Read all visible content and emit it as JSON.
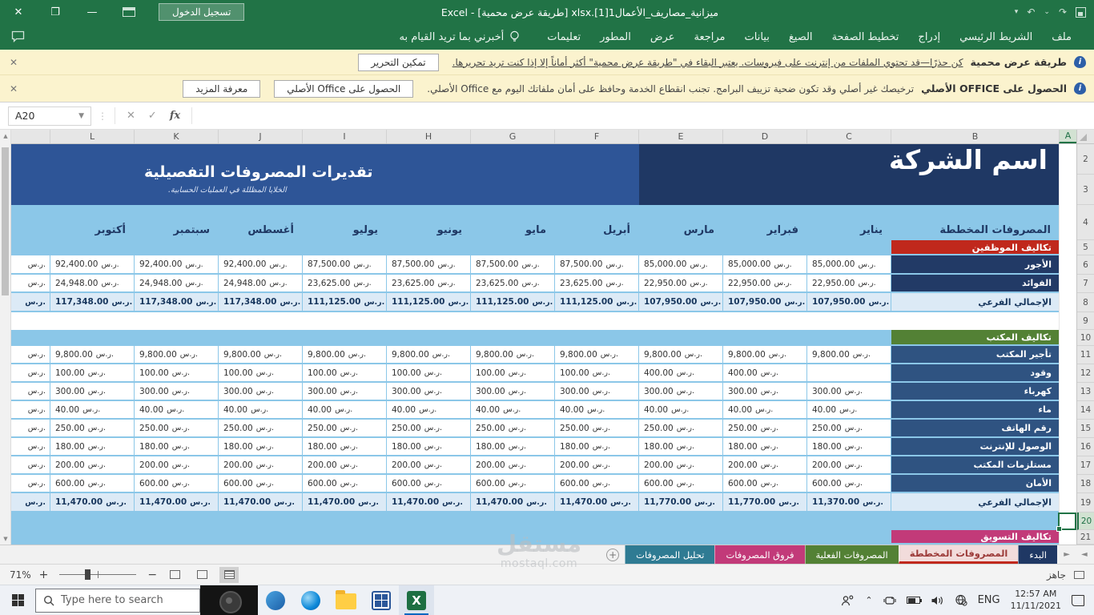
{
  "window": {
    "title": "ميزانية_مصاريف_الأعمال1[1].xlsx [طريقة عرض محمية] - Excel",
    "sign_in_label": "تسجيل الدخول"
  },
  "ribbon": {
    "tabs": [
      "ملف",
      "الشريط الرئيسي",
      "إدراج",
      "تخطيط الصفحة",
      "الصيغ",
      "بيانات",
      "مراجعة",
      "عرض",
      "المطور",
      "تعليمات"
    ],
    "tell_me": "أخبرني بما تريد القيام به"
  },
  "protected_bar": {
    "title": "طريقة عرض محمية",
    "message": "كن حذرًا—قد تحتوي الملفات من إنترنت على فيروسات. يعتبر البقاء في \"طريقة عرض محمية\" أكثر أماناً إلا إذا كنت تريد تحريرها.",
    "button": "تمكين التحرير"
  },
  "genuine_bar": {
    "title": "الحصول على OFFICE الأصلي",
    "message": "ترخيصك غير أصلي وقد تكون ضحية تزييف البرامج. تجنب انقطاع الخدمة وحافظ على أمان ملفاتك اليوم مع Office الأصلي.",
    "button_primary": "الحصول على Office الأصلي",
    "button_secondary": "معرفة المزيد"
  },
  "formula_bar": {
    "name_box": "A20",
    "function_label": "fx",
    "formula": ""
  },
  "grid": {
    "columns": [
      "A",
      "B",
      "C",
      "D",
      "E",
      "F",
      "G",
      "H",
      "I",
      "J",
      "K",
      "L"
    ],
    "rows": [
      "2",
      "3",
      "4",
      "5",
      "6",
      "7",
      "8",
      "9",
      "10",
      "11",
      "12",
      "13",
      "14",
      "15",
      "16",
      "17",
      "18",
      "19",
      "20",
      "21"
    ],
    "active_cell": "A20",
    "accent_color": "#217346"
  },
  "sheet": {
    "company_name": "اسم الشركة",
    "title": "تقديرات المصروفات التفصيلية",
    "subtitle": "الخلايا المظللة في العمليات الحسابية.",
    "header_label": "المصروفات المخططة",
    "months": [
      "يناير",
      "فبراير",
      "مارس",
      "أبريل",
      "مايو",
      "يونيو",
      "يوليو",
      "أغسطس",
      "سبتمبر",
      "أكتوبر"
    ],
    "currency": "ر.س.",
    "sections": [
      {
        "header": "تكاليف الموظفين",
        "color": "#c0281c",
        "row_bg": "#223a66",
        "rows": [
          {
            "label": "الأجور",
            "values": [
              "85,000.00",
              "85,000.00",
              "85,000.00",
              "87,500.00",
              "87,500.00",
              "87,500.00",
              "87,500.00",
              "92,400.00",
              "92,400.00",
              "92,400.00"
            ]
          },
          {
            "label": "الفوائد",
            "values": [
              "22,950.00",
              "22,950.00",
              "22,950.00",
              "23,625.00",
              "23,625.00",
              "23,625.00",
              "23,625.00",
              "24,948.00",
              "24,948.00",
              "24,948.00"
            ]
          }
        ],
        "subtotal": {
          "label": "الإجمالي الفرعي",
          "values": [
            "107,950.00",
            "107,950.00",
            "107,950.00",
            "111,125.00",
            "111,125.00",
            "111,125.00",
            "111,125.00",
            "117,348.00",
            "117,348.00",
            "117,348.00"
          ]
        }
      },
      {
        "header": "تكاليف المكتب",
        "color": "#538135",
        "row_bg": "#2f5381",
        "rows": [
          {
            "label": "تأجير المكتب",
            "values": [
              "9,800.00",
              "9,800.00",
              "9,800.00",
              "9,800.00",
              "9,800.00",
              "9,800.00",
              "9,800.00",
              "9,800.00",
              "9,800.00",
              "9,800.00"
            ]
          },
          {
            "label": "وقود",
            "values": [
              "",
              "400.00",
              "400.00",
              "100.00",
              "100.00",
              "100.00",
              "100.00",
              "100.00",
              "100.00",
              "100.00"
            ]
          },
          {
            "label": "كهرباء",
            "values": [
              "300.00",
              "300.00",
              "300.00",
              "300.00",
              "300.00",
              "300.00",
              "300.00",
              "300.00",
              "300.00",
              "300.00"
            ]
          },
          {
            "label": "ماء",
            "values": [
              "40.00",
              "40.00",
              "40.00",
              "40.00",
              "40.00",
              "40.00",
              "40.00",
              "40.00",
              "40.00",
              "40.00"
            ]
          },
          {
            "label": "رقم الهاتف",
            "values": [
              "250.00",
              "250.00",
              "250.00",
              "250.00",
              "250.00",
              "250.00",
              "250.00",
              "250.00",
              "250.00",
              "250.00"
            ]
          },
          {
            "label": "الوصول للإنترنت",
            "values": [
              "180.00",
              "180.00",
              "180.00",
              "180.00",
              "180.00",
              "180.00",
              "180.00",
              "180.00",
              "180.00",
              "180.00"
            ]
          },
          {
            "label": "مستلزمات المكتب",
            "values": [
              "200.00",
              "200.00",
              "200.00",
              "200.00",
              "200.00",
              "200.00",
              "200.00",
              "200.00",
              "200.00",
              "200.00"
            ]
          },
          {
            "label": "الأمان",
            "values": [
              "600.00",
              "600.00",
              "600.00",
              "600.00",
              "600.00",
              "600.00",
              "600.00",
              "600.00",
              "600.00",
              "600.00"
            ]
          }
        ],
        "subtotal": {
          "label": "الإجمالي الفرعي",
          "values": [
            "11,370.00",
            "11,770.00",
            "11,770.00",
            "11,470.00",
            "11,470.00",
            "11,470.00",
            "11,470.00",
            "11,470.00",
            "11,470.00",
            "11,470.00"
          ]
        }
      },
      {
        "header": "تكاليف التسويق",
        "color": "#c23a79",
        "row_bg": "#2f5381",
        "rows": [],
        "subtotal": null
      }
    ]
  },
  "sheet_tabs": {
    "tabs": [
      {
        "label": "البدء",
        "color": "#1f3864",
        "text_color": "#ffffff",
        "active": false
      },
      {
        "label": "المصروفات المخططة",
        "color": "#f2dcdb",
        "text_color": "#9c3a38",
        "active": true
      },
      {
        "label": "المصروفات الفعلية",
        "color": "#538135",
        "text_color": "#ffffff",
        "active": false
      },
      {
        "label": "فروق المصروفات",
        "color": "#c23a79",
        "text_color": "#ffffff",
        "active": false
      },
      {
        "label": "تحليل المصروفات",
        "color": "#2f7b93",
        "text_color": "#ffffff",
        "active": false
      }
    ]
  },
  "status_bar": {
    "zoom": "71%",
    "ready": "جاهز"
  },
  "taskbar": {
    "search_placeholder": "Type here to search",
    "language": "ENG",
    "time": "12:57 AM",
    "date": "11/11/2021"
  },
  "watermark": {
    "line1": "مستقل",
    "line2": "mostaql.com"
  }
}
